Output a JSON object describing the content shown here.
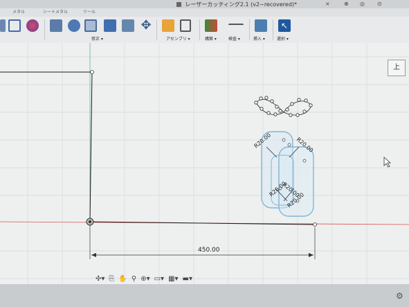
{
  "window": {
    "title": "レーザーカッティング2.1 (v2~recovered)*",
    "controls": [
      "×",
      "⊕",
      "◎",
      "⊙"
    ]
  },
  "tabs": [
    "メタル",
    "シートメタル",
    "ツール"
  ],
  "toolbar": {
    "groups": [
      {
        "label": "修正 ▾"
      },
      {
        "label": "アセンブリ ▾"
      },
      {
        "label": "構築 ▾"
      },
      {
        "label": "検査 ▾"
      },
      {
        "label": "挿入 ▾"
      },
      {
        "label": "選択 ▾"
      }
    ]
  },
  "canvas": {
    "dimension_text": "450.00",
    "radius_labels": [
      "R20.00",
      "R20.00",
      "R20.00",
      "R20.00",
      "R20.00"
    ],
    "viewcube_label": "上",
    "colors": {
      "sketch_line": "#1a1a1a",
      "profile": "#7fb6d6",
      "grid": "#d7dadb",
      "axis_red": "#d9534f"
    }
  },
  "navbar": {
    "icons": [
      "orbit-icon",
      "pan-icon",
      "hand-icon",
      "zoom-icon",
      "fit-icon",
      "display-icon",
      "grid-icon",
      "viewport-icon"
    ]
  }
}
